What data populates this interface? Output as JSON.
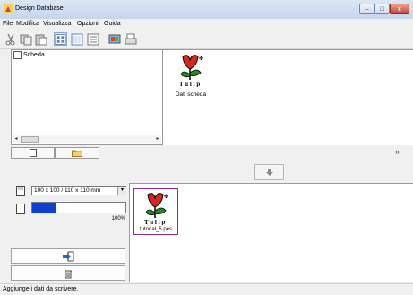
{
  "window": {
    "title": "Design Database",
    "caption_buttons": {
      "minimize": "–",
      "maximize": "□",
      "close": "x"
    }
  },
  "menu": {
    "items": [
      "File",
      "Modifica",
      "Visualizza",
      "Opzioni",
      "Guida"
    ]
  },
  "toolbar": {
    "buttons": [
      "cut-icon",
      "copy-icon",
      "paste-icon",
      "large-icons-view-icon",
      "small-icons-view-icon",
      "list-view-icon",
      "properties-icon",
      "print-icon"
    ]
  },
  "tree": {
    "root_label": "Scheda"
  },
  "card_view": {
    "item_label": "Dati scheda"
  },
  "tabs": {
    "card": "card-icon",
    "folder": "folder-icon"
  },
  "device": {
    "size_option": "100 x 100 / 110 x 110 mm",
    "memory_percent": 25,
    "memory_label": "100%"
  },
  "transfer_view": {
    "item_label": "tutorial_5.pes"
  },
  "status": {
    "text": "Aggiunge i dati da scrivere."
  },
  "colors": {
    "progress": "#0f3edb",
    "selected_border": "#8a2c8f"
  }
}
